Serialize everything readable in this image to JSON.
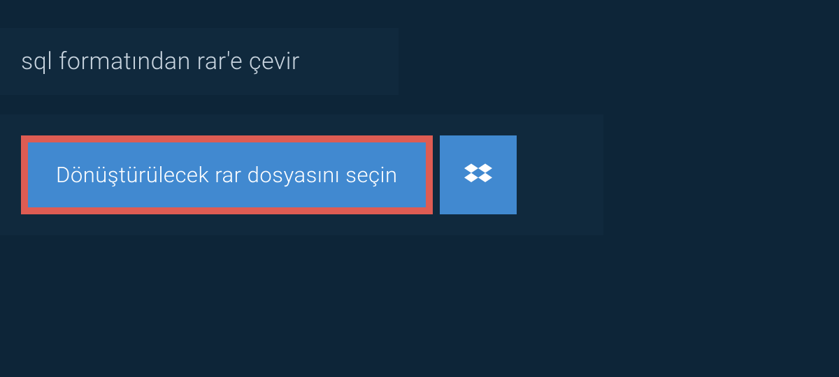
{
  "header": {
    "title": "sql formatından rar'e çevir"
  },
  "upload": {
    "select_file_label": "Dönüştürülecek rar dosyasını seçin"
  }
}
